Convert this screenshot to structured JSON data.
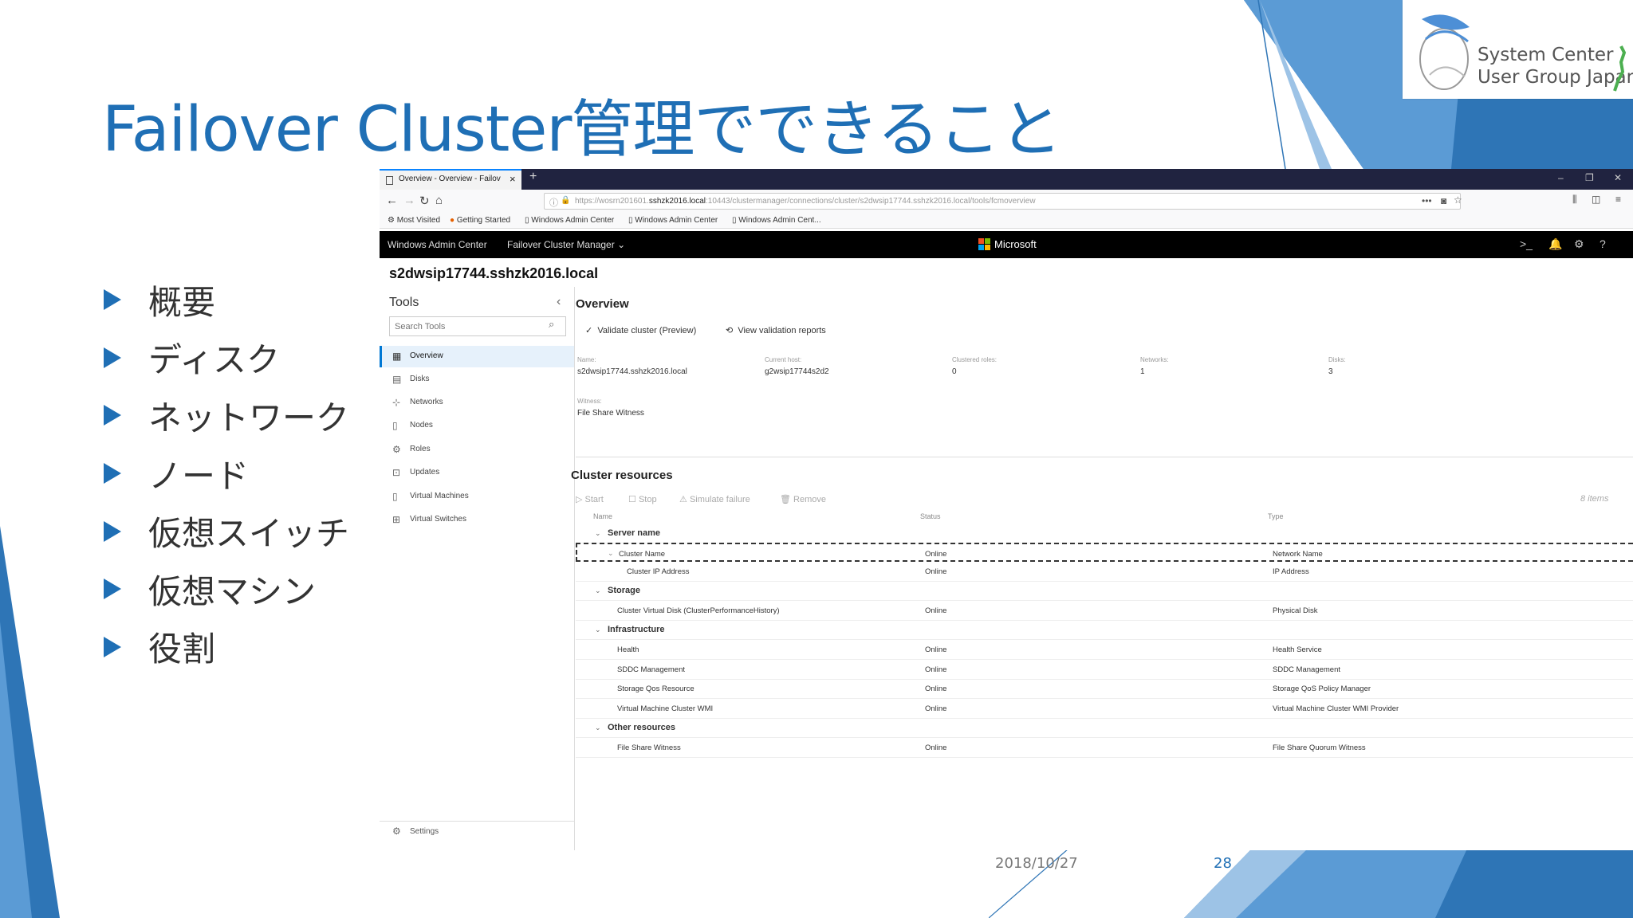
{
  "slide": {
    "title": "Failover Cluster管理でできること",
    "logo_line1": "System Center",
    "logo_line2": "User Group Japan",
    "bullets": [
      "概要",
      "ディスク",
      "ネットワーク",
      "ノード",
      "仮想スイッチ",
      "仮想マシン",
      "役割"
    ],
    "date": "2018/10/27",
    "page": "28",
    "colors": {
      "accent": "#1f6fb5",
      "deco_dark": "#2e75b6",
      "deco_light": "#9dc3e6"
    }
  },
  "browser": {
    "tab_title": "Overview - Overview - Failover",
    "url_prefix": "https://wosrn201601.",
    "url_host": "sshzk2016.local",
    "url_rest": ":10443/clustermanager/connections/cluster/s2dwsip17744.sshzk2016.local/tools/fcmoverview",
    "bookmarks": [
      "Most Visited",
      "Getting Started",
      "Windows Admin Center",
      "Windows Admin Center",
      "Windows Admin Cent..."
    ]
  },
  "wac": {
    "app_name": "Windows Admin Center",
    "tool_menu": "Failover Cluster Manager",
    "brand": "Microsoft",
    "hostname": "s2dwsip17744.sshzk2016.local"
  },
  "sidebar": {
    "title": "Tools",
    "search_placeholder": "Search Tools",
    "items": [
      {
        "label": "Overview",
        "icon": "overview-icon"
      },
      {
        "label": "Disks",
        "icon": "disk-icon"
      },
      {
        "label": "Networks",
        "icon": "network-icon"
      },
      {
        "label": "Nodes",
        "icon": "node-icon"
      },
      {
        "label": "Roles",
        "icon": "gear-icon"
      },
      {
        "label": "Updates",
        "icon": "updates-icon"
      },
      {
        "label": "Virtual Machines",
        "icon": "vm-icon"
      },
      {
        "label": "Virtual Switches",
        "icon": "switch-icon"
      }
    ],
    "settings_label": "Settings"
  },
  "overview": {
    "title": "Overview",
    "validate_label": "Validate cluster (Preview)",
    "reports_label": "View validation reports",
    "fields": [
      {
        "label": "Name:",
        "value": "s2dwsip17744.sshzk2016.local"
      },
      {
        "label": "Current host:",
        "value": "g2wsip17744s2d2"
      },
      {
        "label": "Clustered roles:",
        "value": "0"
      },
      {
        "label": "Networks:",
        "value": "1"
      },
      {
        "label": "Disks:",
        "value": "3"
      }
    ],
    "witness_label": "Witness:",
    "witness_value": "File Share Witness"
  },
  "resources": {
    "title": "Cluster resources",
    "actions": [
      "Start",
      "Stop",
      "Simulate failure",
      "Remove"
    ],
    "count": "8 items",
    "columns": [
      "Name",
      "Status",
      "Type"
    ],
    "groups": [
      {
        "name": "Server name",
        "rows": [
          {
            "name": "Cluster Name",
            "status": "Online",
            "type": "Network Name"
          },
          {
            "name": "Cluster IP Address",
            "status": "Online",
            "type": "IP Address"
          }
        ]
      },
      {
        "name": "Storage",
        "rows": [
          {
            "name": "Cluster Virtual Disk (ClusterPerformanceHistory)",
            "status": "Online",
            "type": "Physical Disk"
          }
        ]
      },
      {
        "name": "Infrastructure",
        "rows": [
          {
            "name": "Health",
            "status": "Online",
            "type": "Health Service"
          },
          {
            "name": "SDDC Management",
            "status": "Online",
            "type": "SDDC Management"
          },
          {
            "name": "Storage Qos Resource",
            "status": "Online",
            "type": "Storage QoS Policy Manager"
          },
          {
            "name": "Virtual Machine Cluster WMI",
            "status": "Online",
            "type": "Virtual Machine Cluster WMI Provider"
          }
        ]
      },
      {
        "name": "Other resources",
        "rows": [
          {
            "name": "File Share Witness",
            "status": "Online",
            "type": "File Share Quorum Witness"
          }
        ]
      }
    ]
  }
}
